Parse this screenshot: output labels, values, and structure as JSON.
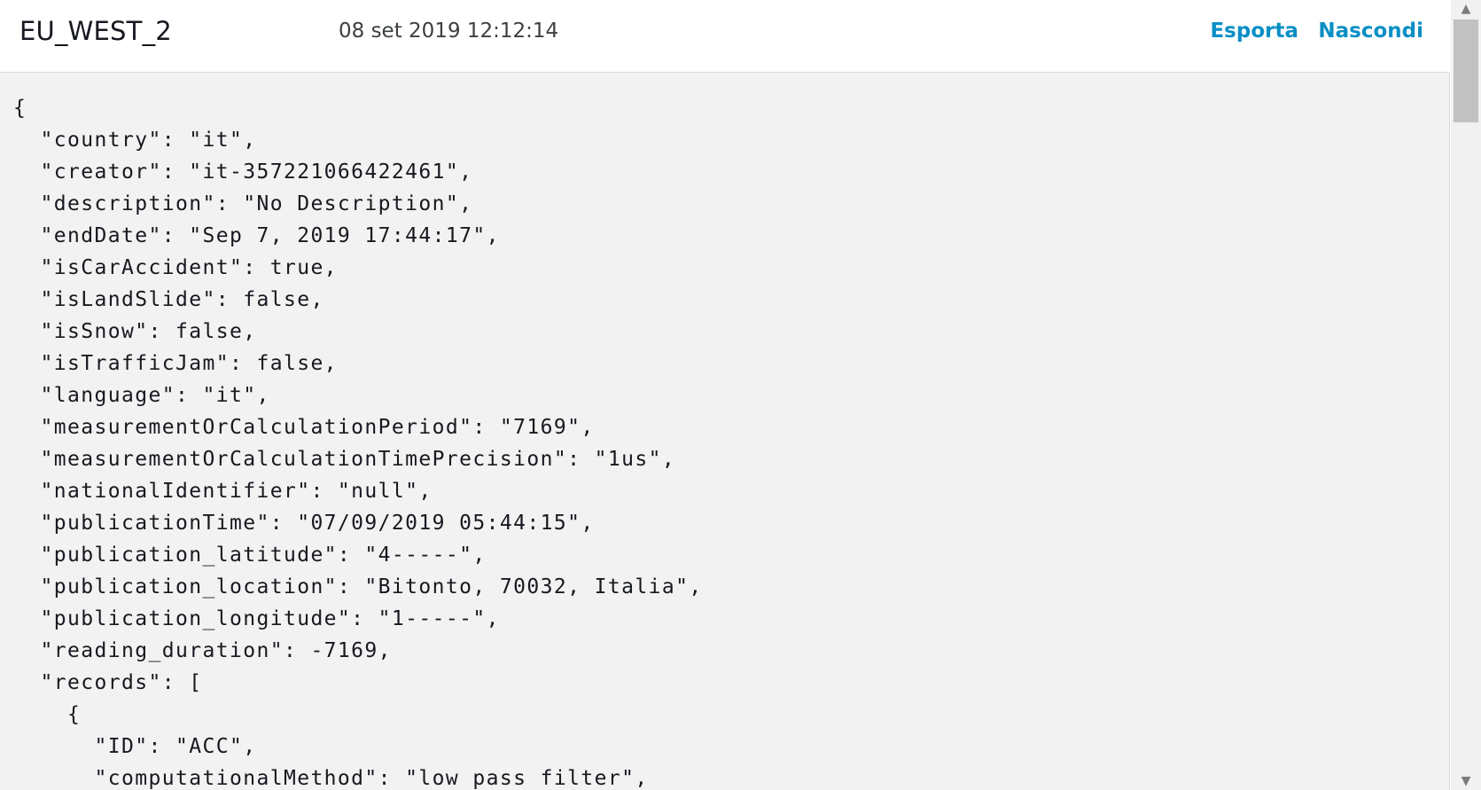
{
  "header": {
    "region": "EU_WEST_2",
    "timestamp": "08 set 2019 12:12:14",
    "export_label": "Esporta",
    "hide_label": "Nascondi"
  },
  "code": {
    "lines": [
      "{",
      "  \"country\": \"it\",",
      "  \"creator\": \"it-357221066422461\",",
      "  \"description\": \"No Description\",",
      "  \"endDate\": \"Sep 7, 2019 17:44:17\",",
      "  \"isCarAccident\": true,",
      "  \"isLandSlide\": false,",
      "  \"isSnow\": false,",
      "  \"isTrafficJam\": false,",
      "  \"language\": \"it\",",
      "  \"measurementOrCalculationPeriod\": \"7169\",",
      "  \"measurementOrCalculationTimePrecision\": \"1us\",",
      "  \"nationalIdentifier\": \"null\",",
      "  \"publicationTime\": \"07/09/2019 05:44:15\",",
      "  \"publication_latitude\": \"4-----\",",
      "  \"publication_location\": \"Bitonto, 70032, Italia\",",
      "  \"publication_longitude\": \"1-----\",",
      "  \"reading_duration\": -7169,",
      "  \"records\": [",
      "    {",
      "      \"ID\": \"ACC\",",
      "      \"computationalMethod\": \"low pass filter\","
    ]
  },
  "colors": {
    "link": "#0a8fc5",
    "code_background": "#f2f2f2",
    "text": "#16191f"
  },
  "icons": {
    "scroll_up": "triangle-up-icon",
    "scroll_down": "triangle-down-icon"
  }
}
